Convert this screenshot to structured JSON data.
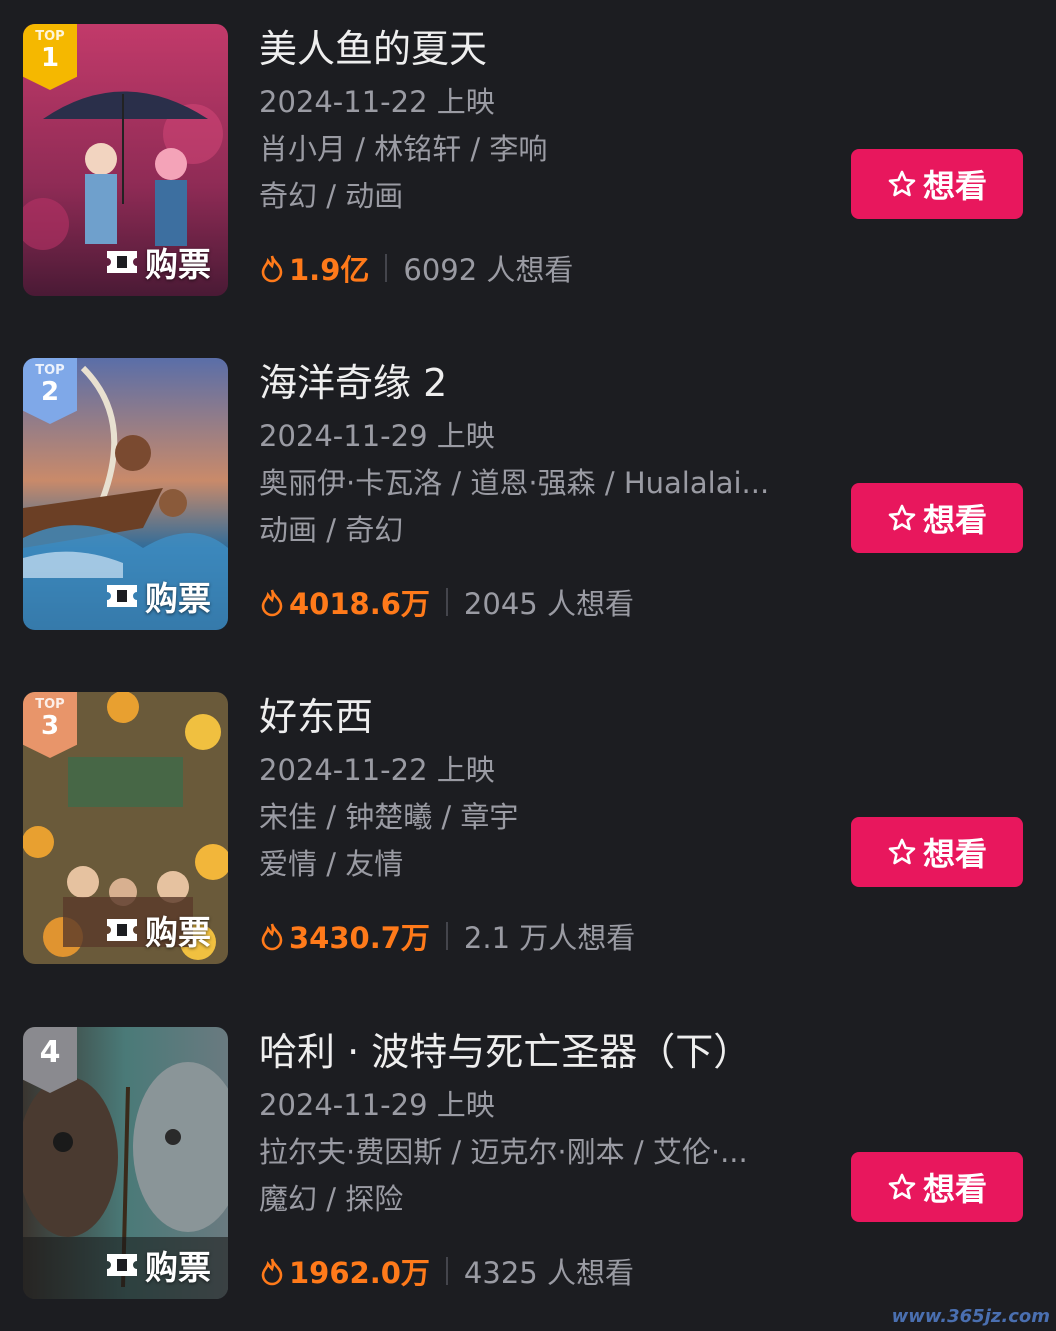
{
  "movies": [
    {
      "rank_top": "TOP",
      "rank": "1",
      "title": "美人鱼的夏天",
      "release": "2024-11-22 上映",
      "cast": "肖小月 / 林铭轩 / 李响",
      "genre": "奇幻 / 动画",
      "heat": "1.9亿",
      "want_count": "6092 人想看",
      "buy_label": "购票",
      "want_button": "想看",
      "badge_color": "#f5b800"
    },
    {
      "rank_top": "TOP",
      "rank": "2",
      "title": "海洋奇缘 2",
      "release": "2024-11-29 上映",
      "cast": "奥丽伊·卡瓦洛 / 道恩·强森 / Hualalai...",
      "genre": "动画 / 奇幻",
      "heat": "4018.6万",
      "want_count": "2045 人想看",
      "buy_label": "购票",
      "want_button": "想看",
      "badge_color": "#7fa8e8"
    },
    {
      "rank_top": "TOP",
      "rank": "3",
      "title": "好东西",
      "release": "2024-11-22 上映",
      "cast": "宋佳 / 钟楚曦 / 章宇",
      "genre": "爱情 / 友情",
      "heat": "3430.7万",
      "want_count": "2.1 万人想看",
      "buy_label": "购票",
      "want_button": "想看",
      "badge_color": "#e8956a"
    },
    {
      "rank_top": "",
      "rank": "4",
      "title": "哈利 · 波特与死亡圣器（下）",
      "release": "2024-11-29 上映",
      "cast": "拉尔夫·费因斯 / 迈克尔·刚本 / 艾伦·...",
      "genre": "魔幻 / 探险",
      "heat": "1962.0万",
      "want_count": "4325 人想看",
      "buy_label": "购票",
      "want_button": "想看",
      "badge_color": "#8a8a8f"
    }
  ],
  "watermark": "www.365jz.com",
  "colors": {
    "background": "#1c1d21",
    "accent": "#e8175d",
    "heat": "#ff7a1a"
  }
}
